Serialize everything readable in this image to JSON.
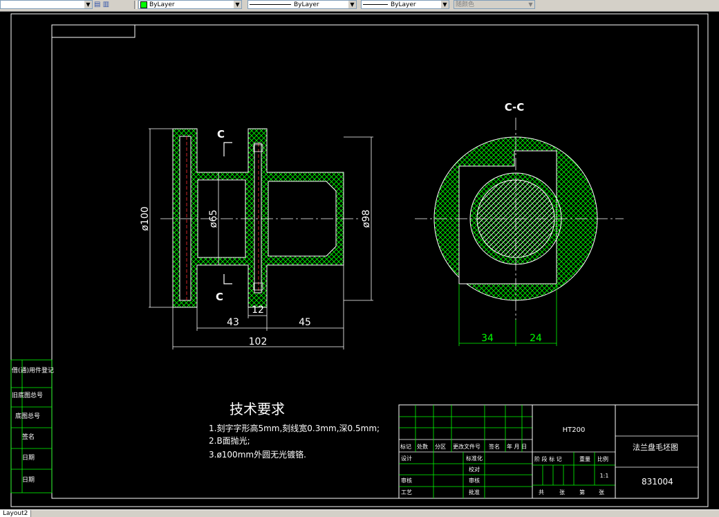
{
  "toolbar": {
    "color_value": "ByLayer",
    "linetype_value": "ByLayer",
    "lineweight_value": "ByLayer",
    "plotstyle_value": "随颜色",
    "arrow": "▼"
  },
  "drawing": {
    "dims": {
      "d100": "ø100",
      "d65": "ø65",
      "d98": "ø98",
      "len12": "12",
      "len43": "43",
      "len45": "45",
      "len102": "102",
      "len34": "34",
      "len24": "24"
    },
    "section_marks": {
      "c_top": "C",
      "c_bottom": "C",
      "section_label": "C-C"
    },
    "tech_requirements": {
      "title": "技术要求",
      "items": [
        "1.刻字字形高5mm,刻线宽0.3mm,深0.5mm;",
        "2.B面抛光;",
        "3.ø100mm外圆无光镀铬."
      ]
    },
    "left_strip": [
      "借(通)用件登记",
      "旧底图总号",
      "底图总号",
      "签名",
      "日期",
      "日期"
    ],
    "title_block": {
      "material": "HT200",
      "part_name": "法兰盘毛坯图",
      "drawing_number": "831004",
      "revision_headers": [
        "标记",
        "处数",
        "分区",
        "更改文件号",
        "签名",
        "年 月 日"
      ],
      "row_labels": {
        "design": "设计",
        "standardize": "标准化",
        "review": "审核",
        "craft": "工艺",
        "audit": "审核",
        "proofread": "校对",
        "approve": "批准"
      },
      "stage_headers": [
        "阶 段 标 记",
        "重量",
        "比例"
      ],
      "scale": "1:1",
      "sheet_row": [
        "共",
        "张",
        "第",
        "张"
      ]
    }
  },
  "statusbar": {
    "layout_tab": "Layout2"
  },
  "colors": {
    "background": "#000000",
    "lines": "#ffffff",
    "hatch": "#00ff00",
    "toolbar": "#d4d0c8"
  }
}
